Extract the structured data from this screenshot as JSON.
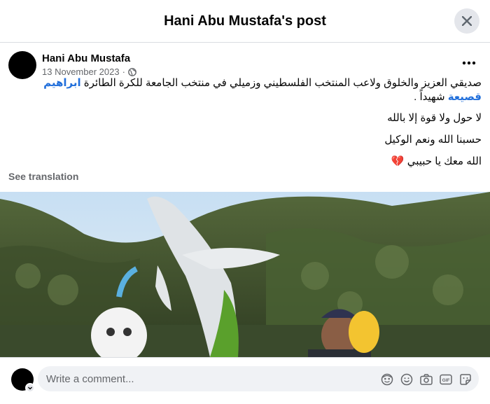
{
  "header": {
    "title": "Hani Abu Mustafa's post"
  },
  "post": {
    "author": "Hani Abu Mustafa",
    "date": "13 November 2023",
    "separator": "·",
    "audience_icon": "globe-icon",
    "text_line1_before": "صديقي العزيز والخلوق ولاعب المنتخب الفلسطيني وزميلي في منتخب الجامعة للكرة الطائرة ",
    "mention": "ابراهيم قصيعة",
    "text_line1_after": " شهيداً .",
    "line2": "لا حول ولا قوة إلا بالله",
    "line3": "حسبنا الله ونعم الوكيل",
    "line4": "الله معك يا حبيبي",
    "line4_emoji": "💔",
    "see_translation": "See translation"
  },
  "comment": {
    "placeholder": "Write a comment...",
    "icons": [
      "avatar-sticker-icon",
      "emoji-icon",
      "camera-icon",
      "gif-icon",
      "sticker-icon"
    ]
  },
  "colors": {
    "link": "#216fdb",
    "secondary": "#65676b",
    "input_bg": "#f0f2f5"
  }
}
